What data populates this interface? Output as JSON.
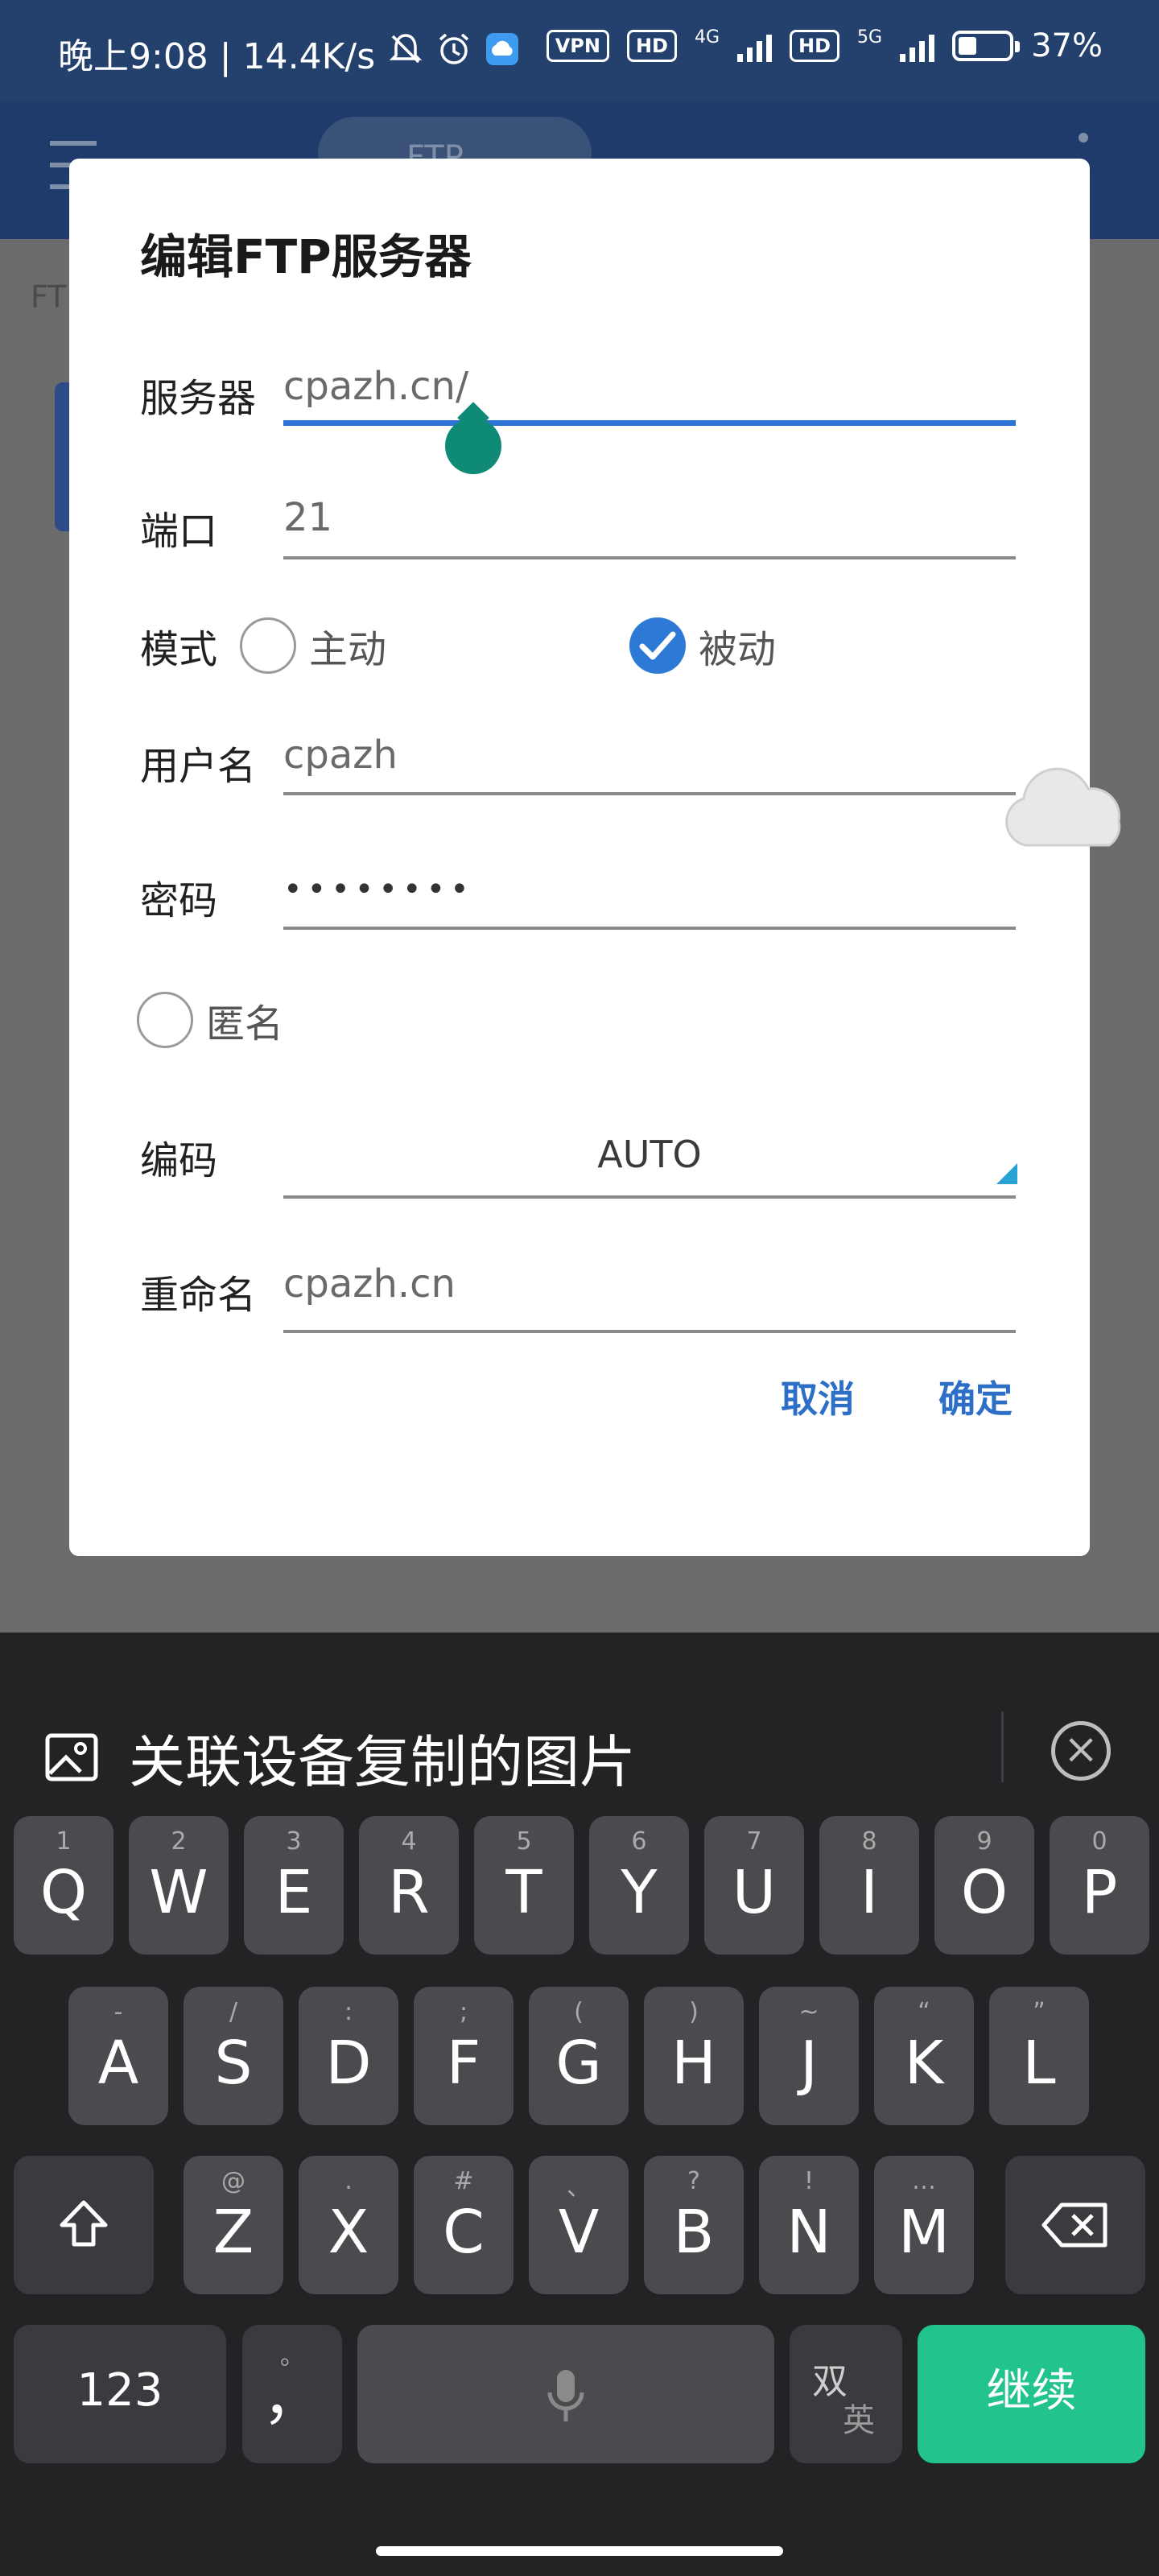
{
  "status_bar": {
    "time_text": "晚上9:08 | 14.4K/s",
    "vpn": "VPN",
    "hd1": "HD",
    "net1": "4G",
    "hd2": "HD",
    "net2": "5G",
    "battery": "37%",
    "battery_level": 0.37
  },
  "app_bar": {
    "tab_label": "FTP",
    "path_text": "FT"
  },
  "dialog": {
    "title": "编辑FTP服务器",
    "server": {
      "label": "服务器",
      "value": "cpazh.cn/"
    },
    "port": {
      "label": "端口",
      "value": "21"
    },
    "mode": {
      "label": "模式",
      "active_label": "主动",
      "passive_label": "被动",
      "selected": "passive"
    },
    "username": {
      "label": "用户名",
      "value": "cpazh"
    },
    "password": {
      "label": "密码",
      "masked": "••••••••"
    },
    "anonymous": {
      "label": "匿名",
      "checked": false
    },
    "encoding": {
      "label": "编码",
      "value": "AUTO"
    },
    "rename": {
      "label": "重命名",
      "value": "cpazh.cn"
    },
    "cancel": "取消",
    "confirm": "确定"
  },
  "keyboard": {
    "suggestion": "关联设备复制的图片",
    "row1": [
      {
        "main": "Q",
        "sub": "1"
      },
      {
        "main": "W",
        "sub": "2"
      },
      {
        "main": "E",
        "sub": "3"
      },
      {
        "main": "R",
        "sub": "4"
      },
      {
        "main": "T",
        "sub": "5"
      },
      {
        "main": "Y",
        "sub": "6"
      },
      {
        "main": "U",
        "sub": "7"
      },
      {
        "main": "I",
        "sub": "8"
      },
      {
        "main": "O",
        "sub": "9"
      },
      {
        "main": "P",
        "sub": "0"
      }
    ],
    "row2": [
      {
        "main": "A",
        "sub": "-"
      },
      {
        "main": "S",
        "sub": "/"
      },
      {
        "main": "D",
        "sub": ":"
      },
      {
        "main": "F",
        "sub": ";"
      },
      {
        "main": "G",
        "sub": "("
      },
      {
        "main": "H",
        "sub": ")"
      },
      {
        "main": "J",
        "sub": "~"
      },
      {
        "main": "K",
        "sub": "“"
      },
      {
        "main": "L",
        "sub": "”"
      }
    ],
    "row3": [
      {
        "main": "Z",
        "sub": "@"
      },
      {
        "main": "X",
        "sub": "."
      },
      {
        "main": "C",
        "sub": "#"
      },
      {
        "main": "V",
        "sub": "、"
      },
      {
        "main": "B",
        "sub": "?"
      },
      {
        "main": "N",
        "sub": "!"
      },
      {
        "main": "M",
        "sub": "…"
      }
    ],
    "num_key": "123",
    "comma_key": "，",
    "comma_sub": "。",
    "lang_key_top": "双",
    "lang_key_bottom": "英",
    "enter_key": "继续"
  },
  "colors": {
    "accent": "#2e73d8",
    "enter": "#22c38e",
    "handle": "#0f8a76"
  }
}
